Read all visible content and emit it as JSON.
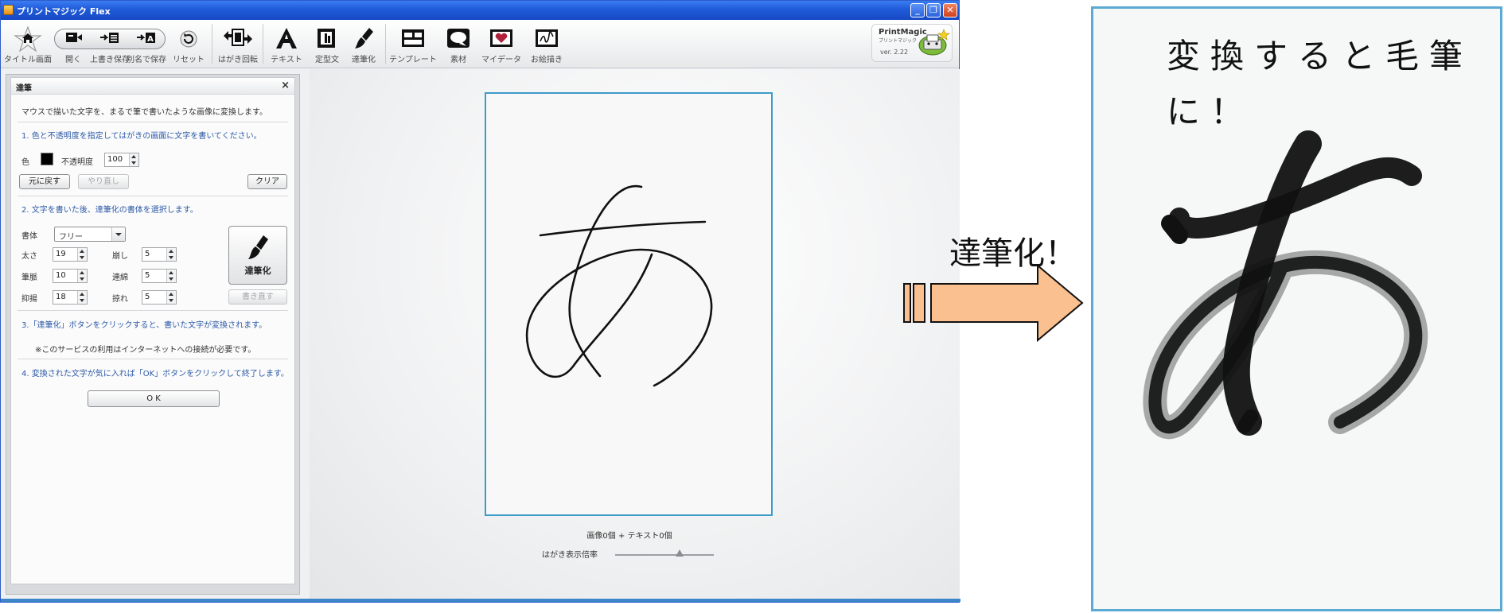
{
  "window": {
    "title": "プリントマジック Flex",
    "minimize": "_",
    "restore": "❐",
    "close": "✕"
  },
  "toolbar": {
    "items": [
      {
        "label": "タイトル画面",
        "icon": "home-icon"
      },
      {
        "label": "開く",
        "icon": "open-icon"
      },
      {
        "label": "上書き保存",
        "icon": "save-icon"
      },
      {
        "label": "別名で保存",
        "icon": "save-as-icon"
      },
      {
        "label": "リセット",
        "icon": "reset-icon"
      },
      {
        "label": "はがき回転",
        "icon": "rotate-icon"
      },
      {
        "label": "テキスト",
        "icon": "text-icon"
      },
      {
        "label": "定型文",
        "icon": "template-text-icon"
      },
      {
        "label": "達筆化",
        "icon": "brush-icon"
      },
      {
        "label": "テンプレート",
        "icon": "layout-icon"
      },
      {
        "label": "素材",
        "icon": "material-icon"
      },
      {
        "label": "マイデータ",
        "icon": "my-data-icon"
      },
      {
        "label": "お絵描き",
        "icon": "drawing-icon"
      }
    ],
    "logo_text": "PrintMagic",
    "logo_sub": "プリントマジック",
    "version": "ver. 2.22"
  },
  "panel": {
    "title": "達筆",
    "close": "×",
    "intro": "マウスで描いた文字を、まるで筆で書いたような画像に変換します。",
    "step1": "1. 色と不透明度を指定してはがきの画面に文字を書いてください。",
    "color_label": "色",
    "color_value": "#000000",
    "opacity_label": "不透明度",
    "opacity_value": "100",
    "undo_label": "元に戻す",
    "redo_label": "やり直し",
    "clear_label": "クリア",
    "step2": "2. 文字を書いた後、達筆化の書体を選択します。",
    "font_label": "書体",
    "font_value": "フリー",
    "params": [
      {
        "label": "太さ",
        "value": "19"
      },
      {
        "label": "筆脈",
        "value": "10"
      },
      {
        "label": "抑揚",
        "value": "18"
      },
      {
        "label": "崩し",
        "value": "5"
      },
      {
        "label": "連綿",
        "value": "5"
      },
      {
        "label": "掠れ",
        "value": "5"
      }
    ],
    "convert_label": "達筆化",
    "rewrite_label": "書き直す",
    "step3": "3.「達筆化」ボタンをクリックすると、書いた文字が変換されます。",
    "note": "※このサービスの利用はインターネットへの接続が必要です。",
    "step4": "4. 変換された文字が気に入れば「OK」ボタンをクリックして終了します。",
    "ok_label": "O K"
  },
  "workspace": {
    "counts": "画像0個 + テキスト0個",
    "zoom_label": "はがき表示倍率",
    "zoom_level": 0.65
  },
  "callout": "達筆化！",
  "result": {
    "caption_line1": "変換すると毛筆",
    "caption_line2": "に！"
  },
  "colors": {
    "accent_blue": "#3d9cc9",
    "arrow_fill": "#fac090",
    "step_text": "#2d5aa8"
  }
}
